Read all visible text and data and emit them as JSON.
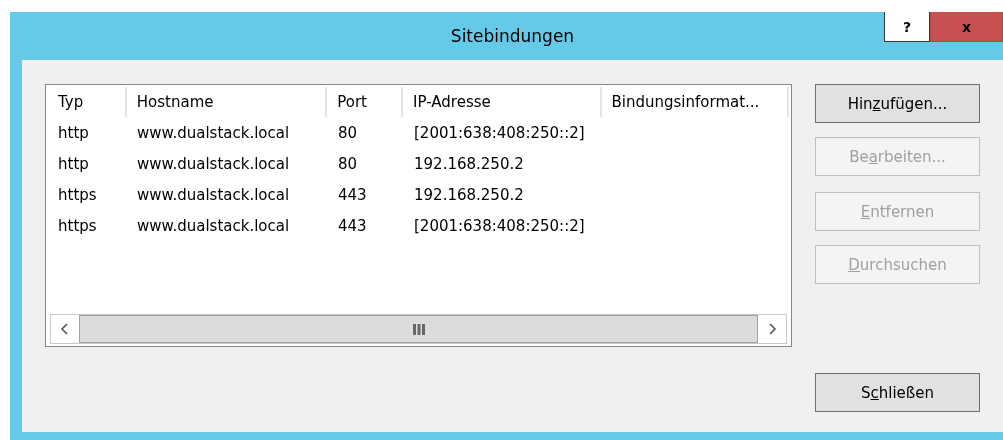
{
  "window": {
    "title": "Sitebindungen",
    "help_button": "?",
    "close_button": "x"
  },
  "table": {
    "columns": [
      "Typ",
      "Hostname",
      "Port",
      "IP-Adresse",
      "Bindungsinformat..."
    ],
    "rows": [
      [
        "http",
        "www.dualstack.local",
        "80",
        "[2001:638:408:250::2]"
      ],
      [
        "http",
        "www.dualstack.local",
        "80",
        "192.168.250.2"
      ],
      [
        "https",
        "www.dualstack.local",
        "443",
        "192.168.250.2"
      ],
      [
        "https",
        "www.dualstack.local",
        "443",
        "[2001:638:408:250::2]"
      ]
    ]
  },
  "buttons": [
    {
      "label": {
        "before": "Hin",
        "access_key": "z",
        "after": "ufügen..."
      },
      "disabled": false
    },
    {
      "label": {
        "before": "Be",
        "access_key": "a",
        "after": "rbeiten..."
      },
      "disabled": true
    },
    {
      "label": {
        "access_key": "E",
        "after": "ntfernen"
      },
      "disabled": true
    },
    {
      "label": {
        "access_key": "D",
        "after": "urchsuchen"
      },
      "disabled": true
    }
  ],
  "close_dialog_button": {
    "label": {
      "before": "S",
      "access_key": "c",
      "after": "hließen"
    },
    "disabled": false
  }
}
